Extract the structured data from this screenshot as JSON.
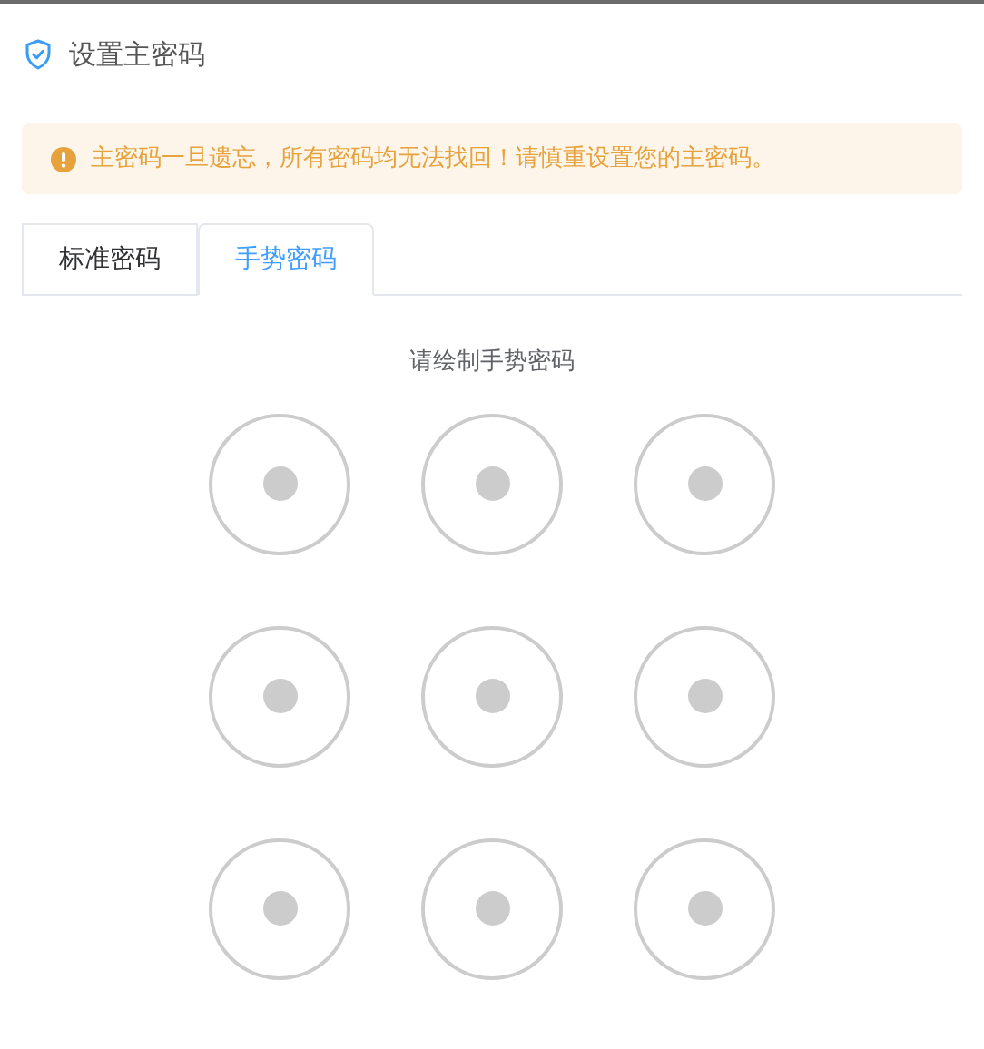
{
  "title": "设置主密码",
  "alert": "主密码一旦遗忘，所有密码均无法找回！请慎重设置您的主密码。",
  "tabs": [
    {
      "label": "标准密码",
      "selected": false
    },
    {
      "label": "手势密码",
      "selected": true
    }
  ],
  "prompt": "请绘制手势密码"
}
